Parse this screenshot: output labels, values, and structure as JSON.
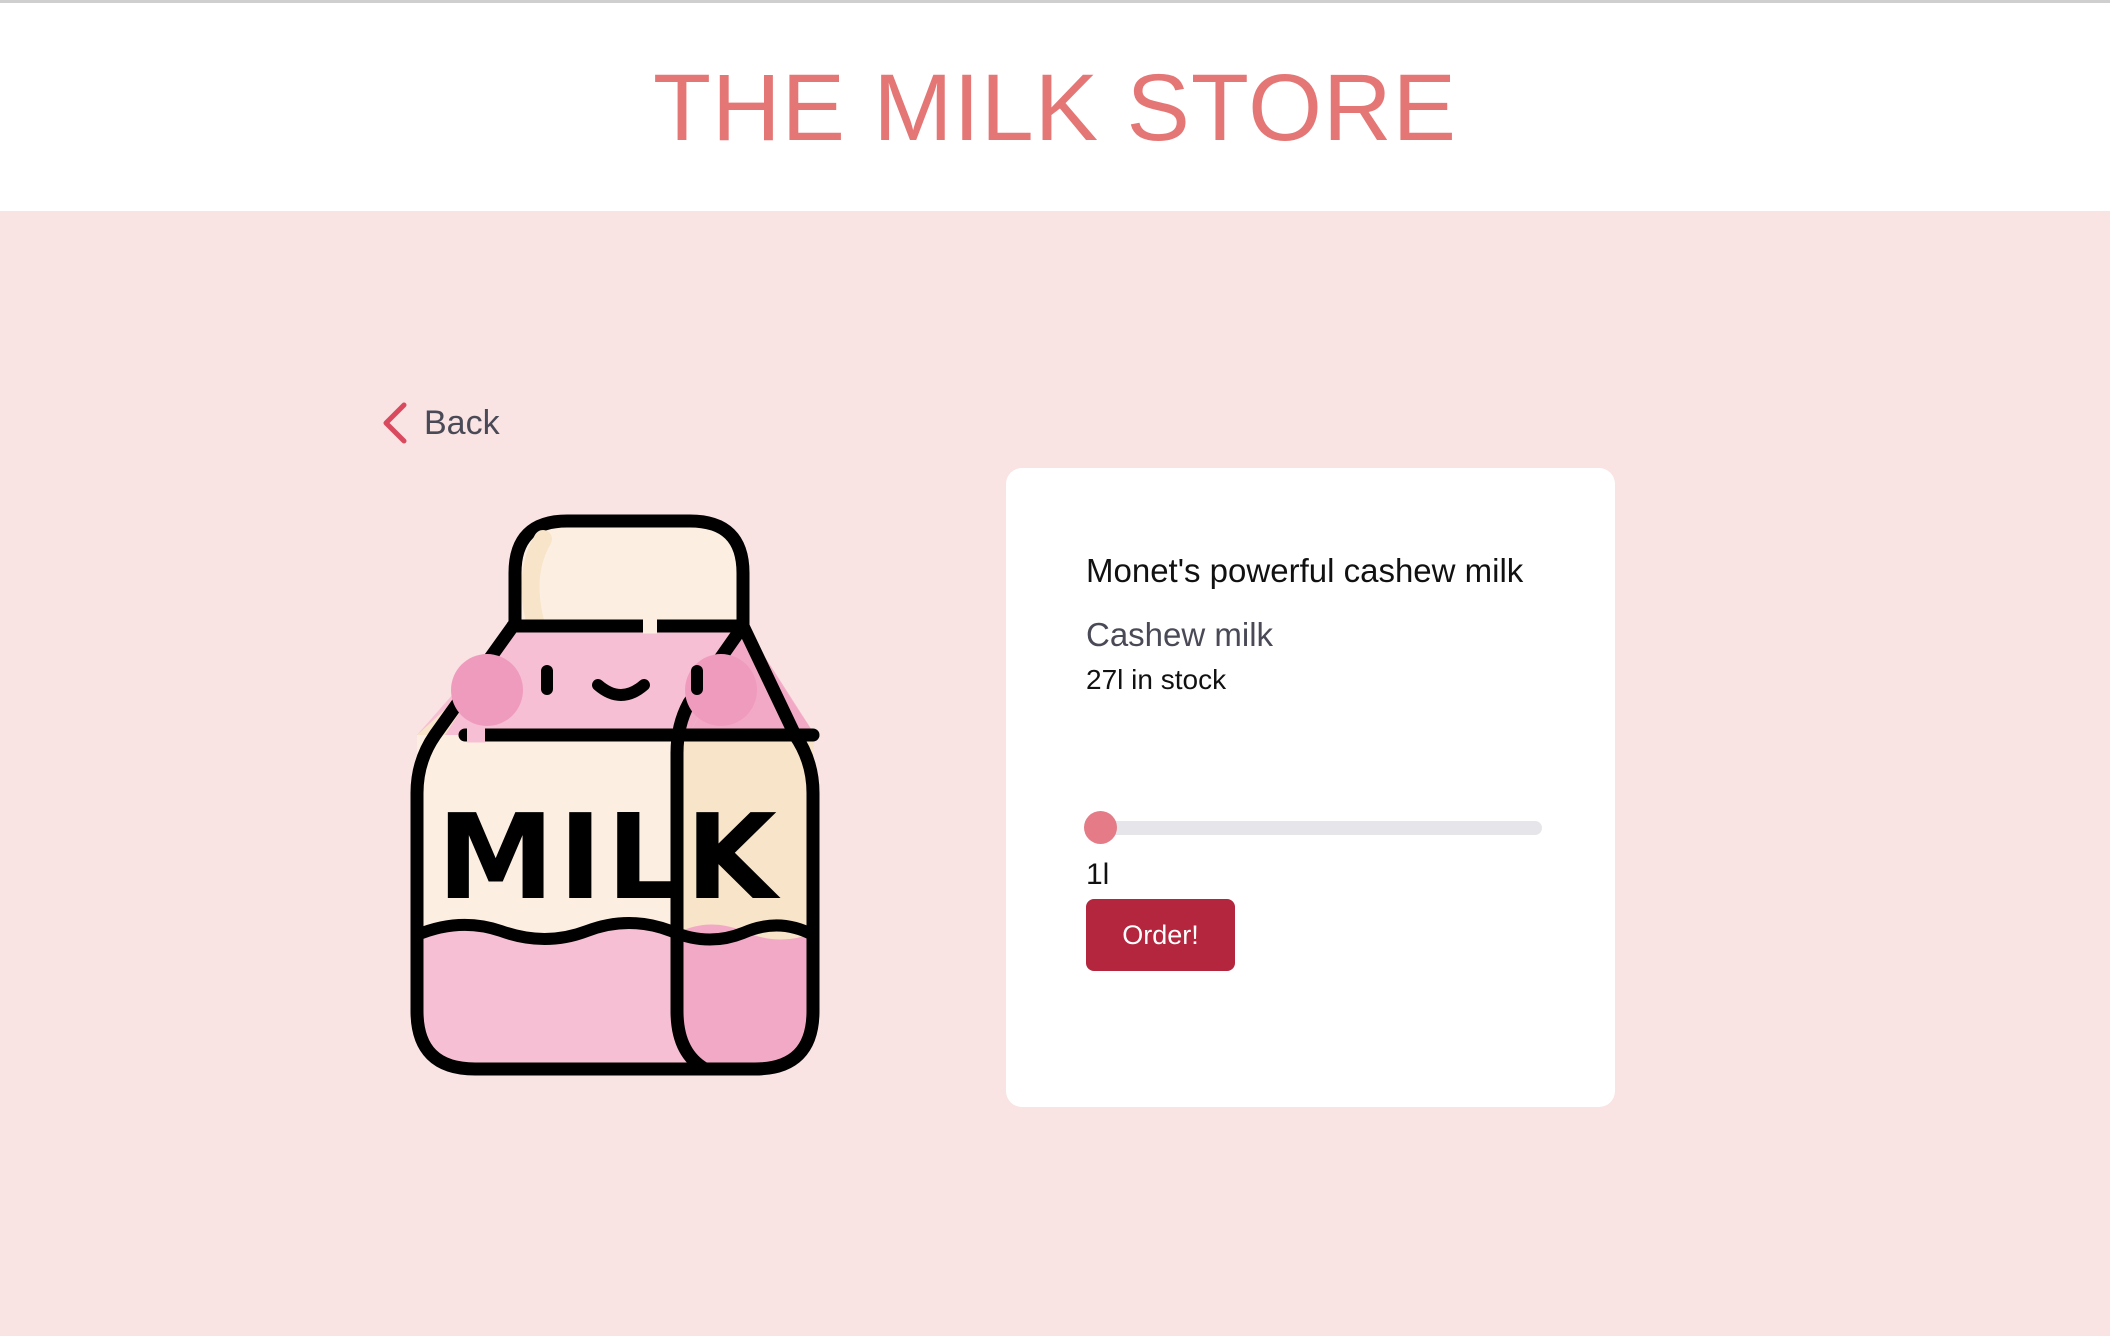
{
  "header": {
    "title": "THE MILK STORE"
  },
  "navigation": {
    "back_label": "Back",
    "back_icon": "chevron-left-icon"
  },
  "product": {
    "illustration": "milk-carton-illustration",
    "illustration_text": "MILK",
    "name": "Monet's powerful cashew milk",
    "type": "Cashew milk",
    "stock_text": "27l in stock",
    "quantity": {
      "value": 1,
      "min": 1,
      "max": 27,
      "display": "1l"
    },
    "order_label": "Order!"
  },
  "colors": {
    "brand": "#e47775",
    "page_background": "#f9e3e3",
    "accent": "#e47b86",
    "button": "#b3263e",
    "muted_text": "#4a4a57"
  }
}
